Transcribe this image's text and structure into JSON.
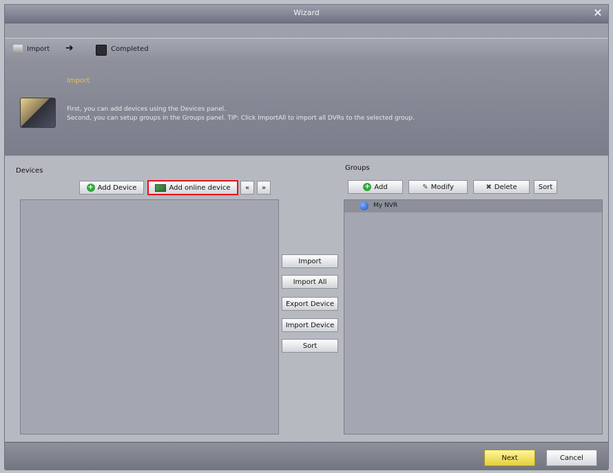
{
  "window": {
    "title": "Wizard",
    "close_icon": "close-icon"
  },
  "steps": {
    "import_label": "Import",
    "completed_label": "Completed"
  },
  "info": {
    "title": "Import",
    "line1": "First, you can add devices using the Devices panel.",
    "line2": "Second, you can setup groups in the Groups panel. TIP: Click ImportAll to import all DVRs to the selected group."
  },
  "devices": {
    "label": "Devices",
    "add_device_label": "Add Device",
    "add_online_device_label": "Add online device",
    "select_all_label": "«",
    "nav_label": "»"
  },
  "middle": {
    "import_label": "Import",
    "import_all_label": "Import All",
    "export_device_label": "Export Device",
    "import_device_label": "Import Device",
    "sort_label": "Sort"
  },
  "groups": {
    "label": "Groups",
    "add_label": "Add",
    "modify_label": "Modify",
    "delete_label": "Delete",
    "sort_label": "Sort",
    "tree_items": [
      "My NVR"
    ]
  },
  "footer": {
    "next_label": "Next",
    "cancel_label": "Cancel"
  },
  "colors": {
    "highlight_border": "#e3101c",
    "next_button": "#f2e45c",
    "info_title": "#e6c24a"
  }
}
